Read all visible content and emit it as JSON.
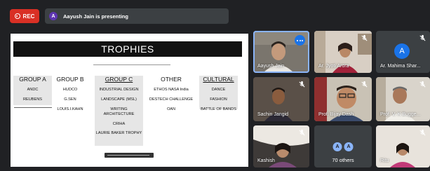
{
  "recording": {
    "label": "REC",
    "color": "#d93025"
  },
  "presenter_banner": {
    "avatar_initial": "A",
    "text": "Aayush Jain is presenting"
  },
  "slide": {
    "title": "TROPHIES",
    "columns": [
      {
        "heading": "GROUP A",
        "items": [
          "ANDC",
          "REUBENS"
        ]
      },
      {
        "heading": "GROUP B",
        "items": [
          "HUDCO",
          "G.SEN",
          "LOUIS.I.KAHN"
        ]
      },
      {
        "heading": "GROUP C",
        "items": [
          "INDUSTRIAL DESIGN",
          "LANDSCAPE (MSL)",
          "WRITING ARCHITECTURE",
          "CRIHA",
          "LAURIE BAKER TROPHY"
        ]
      },
      {
        "heading": "OTHER",
        "items": [
          "ETHOS NASA India",
          "DESTECH CHALLENGE",
          "OAN"
        ]
      },
      {
        "heading": "CULTURAL",
        "items": [
          "DANCE",
          "FASHION",
          "BATTLE OF BANDS"
        ]
      }
    ]
  },
  "participants": [
    {
      "name": "Aayush Jain",
      "active": true,
      "muted": false
    },
    {
      "name": "Ar. Jyoti Arora",
      "muted": true
    },
    {
      "name": "Ar. Mahima Shar...",
      "avatar_initial": "A",
      "avatar_color": "#1a73e8",
      "muted": true
    },
    {
      "name": "Sachin Jangid",
      "muted": true
    },
    {
      "name": "Prof. Bijay Dash",
      "muted": true
    },
    {
      "name": "Prof. V. K Bugge...",
      "muted": true
    },
    {
      "name": "Kashish",
      "muted": true
    },
    {
      "name": "Ritu",
      "muted": true
    }
  ],
  "others": {
    "initials": [
      "A",
      "A"
    ],
    "count_label": "70 others"
  }
}
